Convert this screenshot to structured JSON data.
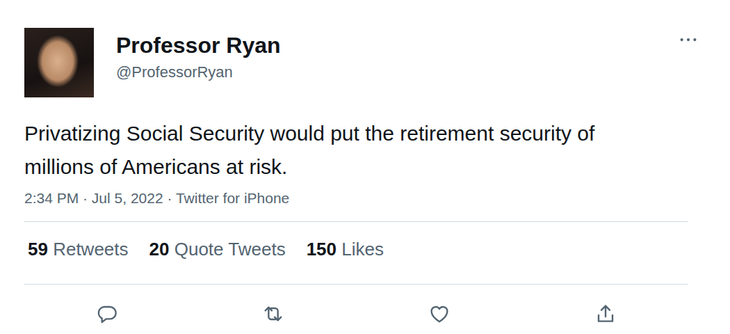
{
  "user": {
    "name": "Professor Ryan",
    "handle": "@ProfessorRyan"
  },
  "tweet": {
    "text": "Privatizing Social Security would put the retirement security of millions of Americans at risk.",
    "meta": "2:34 PM · Jul 5, 2022 · Twitter for iPhone"
  },
  "stats": [
    {
      "count": "59",
      "label": "Retweets"
    },
    {
      "count": "20",
      "label": "Quote Tweets"
    },
    {
      "count": "150",
      "label": "Likes"
    }
  ]
}
